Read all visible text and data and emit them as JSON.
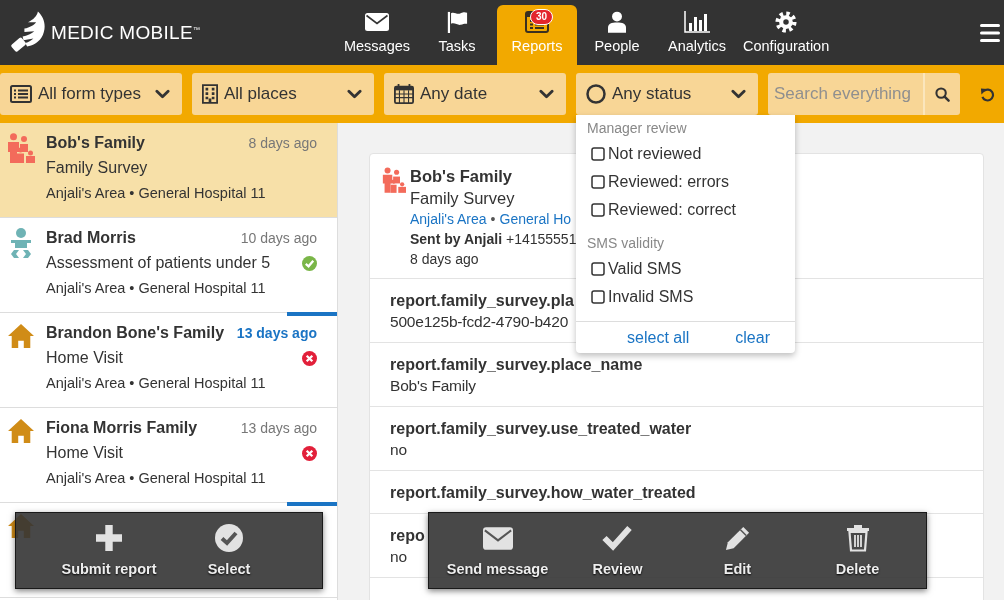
{
  "header": {
    "logo": "MEDIC MOBILE$^{™}$",
    "tabs": [
      {
        "label": "Messages",
        "kind": "messages",
        "selected": false
      },
      {
        "label": "Tasks",
        "kind": "tasks",
        "selected": false
      },
      {
        "label": "Reports",
        "kind": "reports",
        "selected": true,
        "badge": "30"
      },
      {
        "label": "People",
        "kind": "people",
        "selected": false
      },
      {
        "label": "Analytics",
        "kind": "analytics",
        "selected": false
      },
      {
        "label": "Configuration",
        "kind": "configuration",
        "selected": false
      }
    ]
  },
  "filters": {
    "buttons": [
      {
        "label": "All form types",
        "kind": "forms",
        "expanded": false
      },
      {
        "label": "All places",
        "kind": "places",
        "expanded": false
      },
      {
        "label": "Any date",
        "kind": "date",
        "expanded": false
      },
      {
        "label": "Any status",
        "kind": "status",
        "expanded": true
      }
    ],
    "search": {
      "placeholder": "Search everything"
    }
  },
  "status_menu": {
    "sections": [
      {
        "heading": "Manager review",
        "options": [
          {
            "label": "Not reviewed",
            "checked": false
          },
          {
            "label": "Reviewed: errors",
            "checked": false
          },
          {
            "label": "Reviewed: correct",
            "checked": false
          }
        ]
      },
      {
        "heading": "SMS validity",
        "options": [
          {
            "label": "Valid SMS",
            "checked": false
          },
          {
            "label": "Invalid SMS",
            "checked": false
          }
        ]
      }
    ],
    "actions": [
      "select all",
      "clear"
    ]
  },
  "reports": [
    {
      "name": "Bob's Family",
      "form": "Family Survey",
      "place": "Anjali's Area • General Hospital 11",
      "date": "8 days ago",
      "kind": "survey",
      "selected": true,
      "unread": false
    },
    {
      "name": "Brad Morris",
      "form": "Assessment of patients under 5",
      "place": "Anjali's Area • General Hospital 11",
      "date": "10 days ago",
      "kind": "assessment",
      "selected": false,
      "unread": false,
      "status": {
        "kind": "correct"
      }
    },
    {
      "name": "Brandon Bone's Family",
      "form": "Home Visit",
      "place": "Anjali's Area • General Hospital 11",
      "date": "13 days ago",
      "kind": "visit",
      "selected": false,
      "unread": true,
      "status": {
        "kind": "errors"
      }
    },
    {
      "name": "Fiona Morris Family",
      "form": "Home Visit",
      "place": "Anjali's Area • General Hospital 11",
      "date": "13 days ago",
      "kind": "visit",
      "selected": false,
      "unread": false,
      "status": {
        "kind": "errors"
      }
    },
    {
      "kind": "visit",
      "selected": false,
      "unread": true
    }
  ],
  "detail": {
    "kind": "survey",
    "name": "Bob's Family",
    "form": "Family Survey",
    "place": [
      "Anjali's Area",
      "General Ho"
    ],
    "separator": "•",
    "sender": "**Sent by Anjali** +14155551",
    "date": "8 days ago",
    "fields": [
      {
        "label": "report.family_survey.pla",
        "value": "500e125b-fcd2-4790-b420"
      },
      {
        "label": "report.family_survey.place_name",
        "value": "Bob's Family"
      },
      {
        "label": "report.family_survey.use_treated_water",
        "value": "no"
      },
      {
        "label": "report.family_survey.how_water_treated"
      },
      {
        "label": "repo",
        "value": "no"
      }
    ]
  },
  "list_actions": [
    {
      "label": "Submit report",
      "kind": "add"
    },
    {
      "label": "Select",
      "kind": "select"
    }
  ],
  "report_actions": [
    {
      "label": "Send message",
      "kind": "message"
    },
    {
      "label": "Review",
      "kind": "review"
    },
    {
      "label": "Edit",
      "kind": "edit"
    },
    {
      "label": "Delete",
      "kind": "delete"
    }
  ]
}
